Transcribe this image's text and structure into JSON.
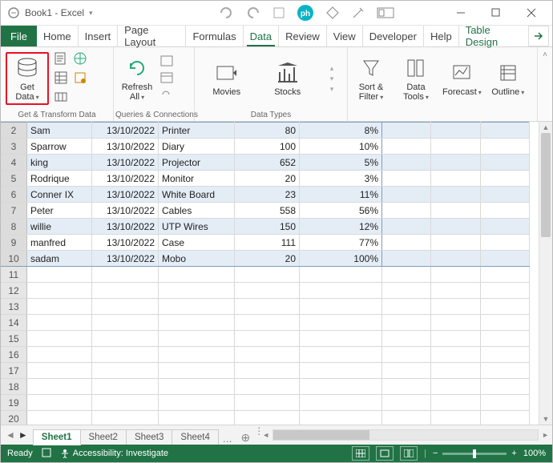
{
  "title": "Book1  -  Excel",
  "tabs": {
    "file": "File",
    "home": "Home",
    "insert": "Insert",
    "page_layout": "Page Layout",
    "formulas": "Formulas",
    "data": "Data",
    "review": "Review",
    "view": "View",
    "developer": "Developer",
    "help": "Help",
    "table_design": "Table Design"
  },
  "ribbon": {
    "get_data": "Get\nData",
    "group_transform": "Get & Transform Data",
    "refresh_all": "Refresh\nAll",
    "group_queries": "Queries & Connections",
    "movies": "Movies",
    "stocks": "Stocks",
    "group_datatypes": "Data Types",
    "sort_filter": "Sort &\nFilter",
    "data_tools": "Data\nTools",
    "forecast": "Forecast",
    "outline": "Outline"
  },
  "rows": [
    {
      "n": "2",
      "a": "Sam",
      "b": "13/10/2022",
      "c": "Printer",
      "d": "80",
      "e": "8%",
      "band": true,
      "top": true
    },
    {
      "n": "3",
      "a": "Sparrow",
      "b": "13/10/2022",
      "c": "Diary",
      "d": "100",
      "e": "10%",
      "band": false
    },
    {
      "n": "4",
      "a": "king",
      "b": "13/10/2022",
      "c": "Projector",
      "d": "652",
      "e": "5%",
      "band": true
    },
    {
      "n": "5",
      "a": "Rodrique",
      "b": "13/10/2022",
      "c": "Monitor",
      "d": "20",
      "e": "3%",
      "band": false
    },
    {
      "n": "6",
      "a": "Conner IX",
      "b": "13/10/2022",
      "c": "White Board",
      "d": "23",
      "e": "11%",
      "band": true
    },
    {
      "n": "7",
      "a": "Peter",
      "b": "13/10/2022",
      "c": "Cables",
      "d": "558",
      "e": "56%",
      "band": false
    },
    {
      "n": "8",
      "a": "willie",
      "b": "13/10/2022",
      "c": "UTP Wires",
      "d": "150",
      "e": "12%",
      "band": true
    },
    {
      "n": "9",
      "a": "manfred",
      "b": "13/10/2022",
      "c": "Case",
      "d": "111",
      "e": "77%",
      "band": false
    },
    {
      "n": "10",
      "a": "sadam",
      "b": "13/10/2022",
      "c": "Mobo",
      "d": "20",
      "e": "100%",
      "band": true,
      "last": true
    }
  ],
  "empty_rows": [
    "11",
    "12",
    "13",
    "14",
    "15",
    "16",
    "17",
    "18",
    "19",
    "20"
  ],
  "sheets": {
    "s1": "Sheet1",
    "s2": "Sheet2",
    "s3": "Sheet3",
    "s4": "Sheet4",
    "more": "..."
  },
  "status": {
    "ready": "Ready",
    "access": "Accessibility: Investigate",
    "zoom": "100%"
  }
}
